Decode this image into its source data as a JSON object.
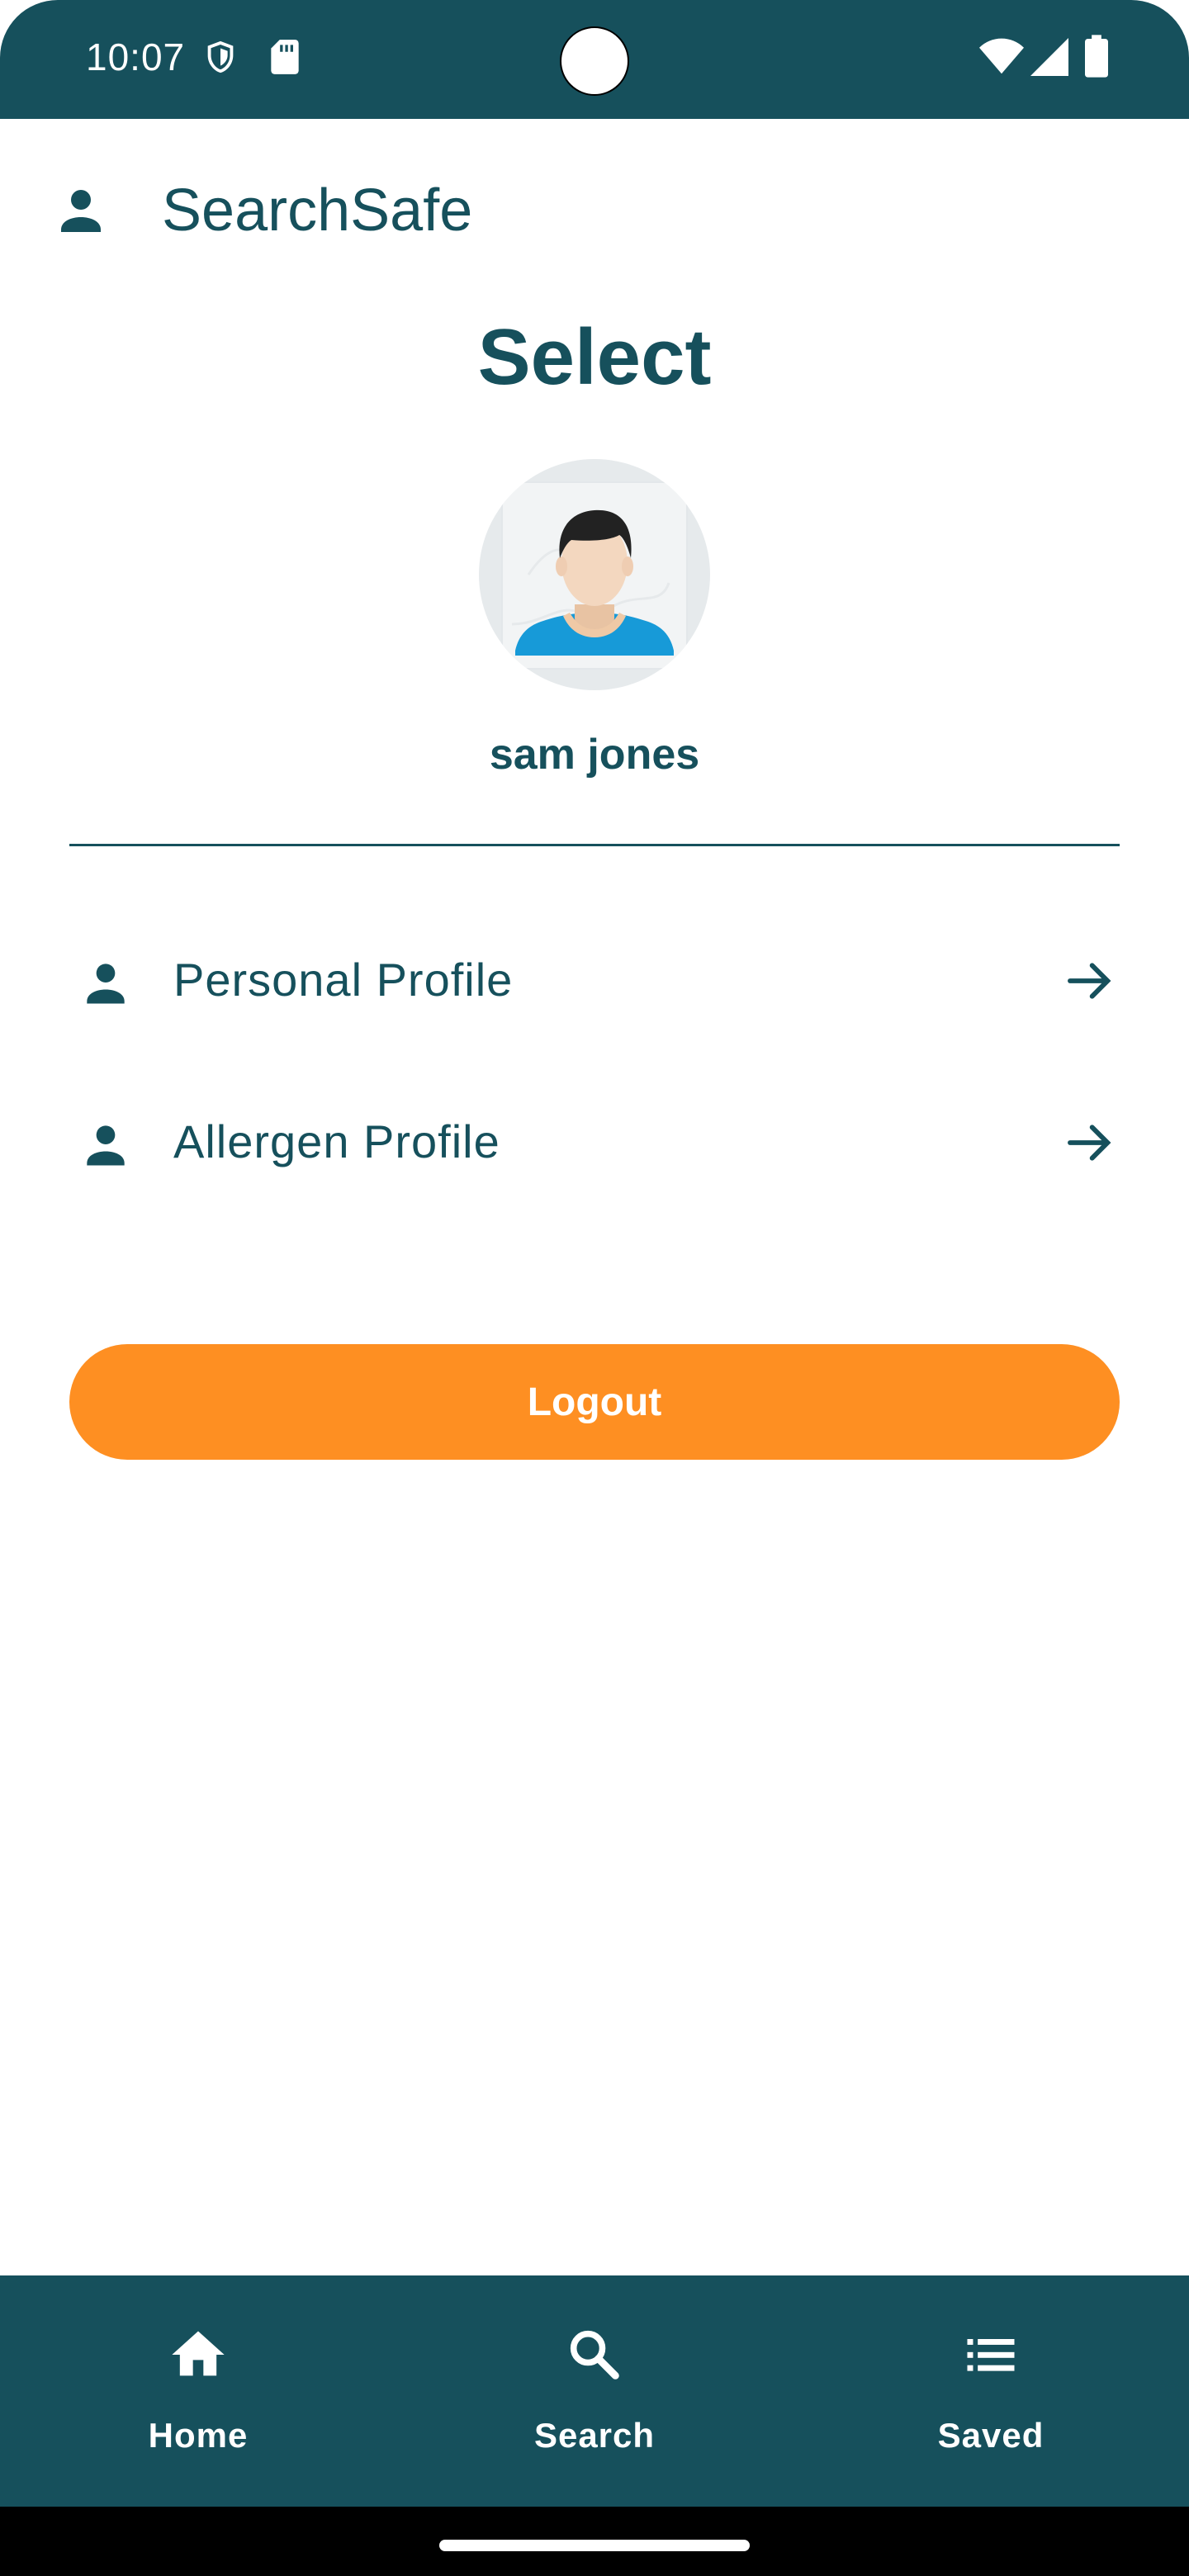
{
  "status_bar": {
    "time": "10:07",
    "icons": [
      "shield-icon",
      "sd-card-icon",
      "wifi-icon",
      "signal-icon",
      "battery-icon"
    ]
  },
  "header": {
    "icon": "person-icon",
    "title": "SearchSafe"
  },
  "page": {
    "title": "Select",
    "avatar": "user-avatar",
    "user_name": "sam jones"
  },
  "menu": {
    "items": [
      {
        "label": "Personal Profile",
        "icon": "person-icon",
        "trailing_icon": "arrow-right-icon"
      },
      {
        "label": "Allergen Profile",
        "icon": "person-icon",
        "trailing_icon": "arrow-right-icon"
      }
    ]
  },
  "logout": {
    "label": "Logout"
  },
  "bottom_nav": {
    "items": [
      {
        "label": "Home",
        "icon": "home-icon"
      },
      {
        "label": "Search",
        "icon": "search-icon"
      },
      {
        "label": "Saved",
        "icon": "list-icon"
      }
    ]
  },
  "colors": {
    "primary": "#16505c",
    "accent": "#fe8f22",
    "background": "#ffffff",
    "on_primary": "#ffffff"
  }
}
